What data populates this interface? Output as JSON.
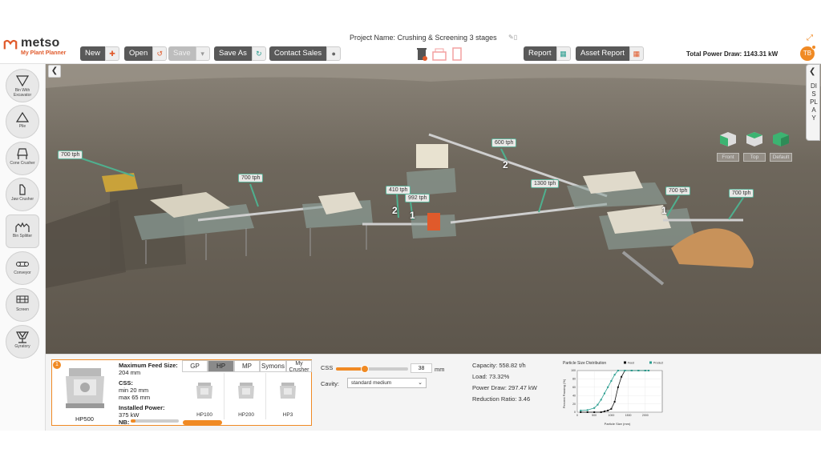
{
  "header": {
    "project_title": "Project Name: Crushing & Screening 3 stages",
    "total_power": "Total Power Draw: 1143.31 kW",
    "user_initials": "TB"
  },
  "brand": {
    "name": "metso",
    "tagline": "My Plant Planner",
    "accent": "#e05a2b"
  },
  "toolbar": {
    "new_label": "New",
    "open_label": "Open",
    "save_label": "Save",
    "save_as_label": "Save As",
    "contact_label": "Contact Sales",
    "report_label": "Report",
    "asset_report_label": "Asset Report"
  },
  "sidebar": {
    "items": [
      {
        "label": "Bin With Excavator",
        "icon": "triangle-down-icon"
      },
      {
        "label": "Pile",
        "icon": "triangle-up-icon"
      },
      {
        "label": "Cone Crusher",
        "icon": "cone-crusher-icon"
      },
      {
        "label": "Jaw Crusher",
        "icon": "jaw-crusher-icon"
      },
      {
        "label": "Bin Splitter",
        "icon": "bin-splitter-icon"
      },
      {
        "label": "Conveyor",
        "icon": "conveyor-icon"
      },
      {
        "label": "Screen",
        "icon": "screen-icon"
      },
      {
        "label": "Gyratory",
        "icon": "gyratory-icon"
      }
    ]
  },
  "viewport": {
    "view_buttons": [
      "Front",
      "Top",
      "Default"
    ],
    "display_label": "DISPLAY",
    "flow_labels": [
      "700 tph",
      "700 tph",
      "410 tph",
      "992 tph",
      "600 tph",
      "1300 tph",
      "700 tph",
      "700 tph"
    ],
    "stage_numbers": [
      "2",
      "1",
      "2",
      "1"
    ]
  },
  "equipment": {
    "badge": "1",
    "model": "HP500",
    "max_feed_label": "Maximum Feed Size:",
    "max_feed_value": "204 mm",
    "css_label": "CSS:",
    "css_min": "min 20 mm",
    "css_max": "max 65 mm",
    "power_label": "Installed Power:",
    "power_value": "375 kW",
    "nb_label": "NB:",
    "nb_level": 0.1
  },
  "model_tabs": [
    "GP",
    "HP",
    "MP",
    "Symons",
    "My Crusher"
  ],
  "active_tab": "HP",
  "models": [
    "HP100",
    "HP200",
    "HP3"
  ],
  "controls": {
    "css_label": "CSS",
    "css_value": "38",
    "css_unit": "mm",
    "css_fraction": 0.4,
    "cavity_label": "Cavity:",
    "cavity_value": "standard medium"
  },
  "stats": {
    "capacity": "Capacity: 558.82 t/h",
    "load": "Load: 73.32%",
    "power": "Power Draw: 297.47 kW",
    "reduction": "Reduction Ratio: 3.46"
  },
  "chart_data": {
    "type": "line",
    "title": "Particle Size Distribution",
    "xlabel": "Particle Size (mm)",
    "ylabel": "Percent Passing (%)",
    "xlim": [
      0,
      2500
    ],
    "ylim": [
      0,
      100
    ],
    "x_ticks": [
      0,
      500,
      1000,
      1500,
      2000
    ],
    "y_ticks": [
      0,
      20,
      40,
      60,
      80,
      100
    ],
    "legend_position": "top",
    "series": [
      {
        "name": "Feed",
        "color": "#111111",
        "x": [
          100,
          300,
          500,
          700,
          800,
          900,
          1000,
          1100,
          1200,
          1300,
          1400,
          1600,
          1800,
          2000,
          2100
        ],
        "y": [
          0,
          0,
          0,
          0,
          2,
          4,
          8,
          25,
          60,
          85,
          100,
          100,
          100,
          100,
          100
        ]
      },
      {
        "name": "Product",
        "color": "#2a9d8f",
        "x": [
          100,
          300,
          500,
          600,
          700,
          800,
          900,
          1000,
          1100,
          1200,
          1400,
          1600,
          1800,
          2000,
          2100
        ],
        "y": [
          4,
          5,
          10,
          18,
          30,
          45,
          60,
          75,
          90,
          100,
          100,
          100,
          100,
          100,
          100
        ]
      }
    ]
  }
}
